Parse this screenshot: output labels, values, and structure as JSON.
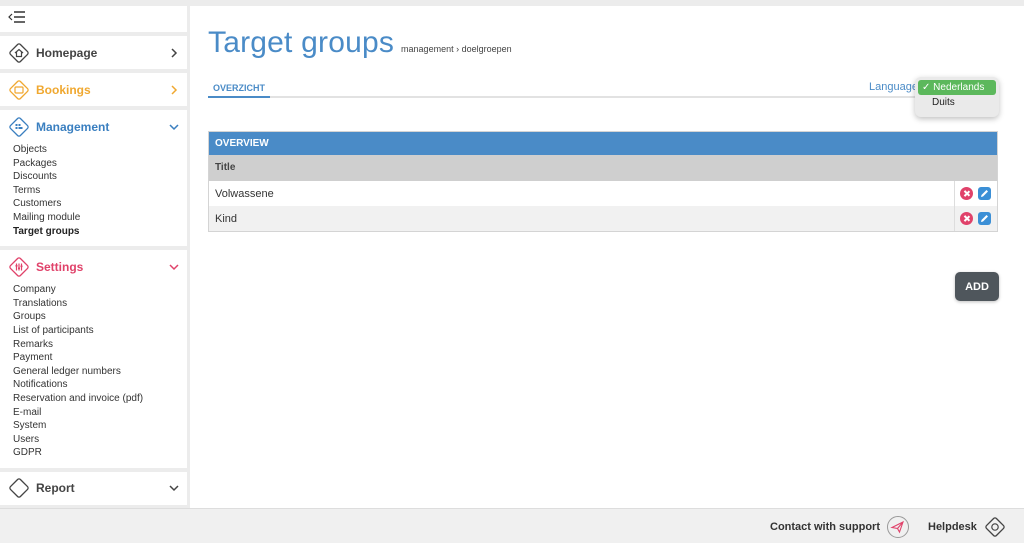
{
  "sidebar": {
    "sections": [
      {
        "label": "Homepage",
        "color": "#444444",
        "icon": "home-icon",
        "chevron": "right"
      },
      {
        "label": "Bookings",
        "color": "#f0a830",
        "icon": "bookings-icon",
        "chevron": "right"
      },
      {
        "label": "Management",
        "color": "#3a7fc0",
        "icon": "management-icon",
        "chevron": "down",
        "items": [
          "Objects",
          "Packages",
          "Discounts",
          "Terms",
          "Customers",
          "Mailing module",
          "Target groups"
        ],
        "active": "Target groups"
      },
      {
        "label": "Settings",
        "color": "#e0426a",
        "icon": "settings-icon",
        "chevron": "down",
        "items": [
          "Company",
          "Translations",
          "Groups",
          "List of participants",
          "Remarks",
          "Payment",
          "General ledger numbers",
          "Notifications",
          "Reservation and invoice (pdf)",
          "E-mail",
          "System",
          "Users",
          "GDPR"
        ]
      },
      {
        "label": "Report",
        "color": "#444444",
        "icon": "report-icon",
        "chevron": "down"
      }
    ]
  },
  "header": {
    "title": "Target groups",
    "breadcrumb": [
      "management",
      "doelgroepen"
    ],
    "breadcrumb_sep": "›"
  },
  "tabs": [
    {
      "label": "OVERZICHT",
      "active": true
    }
  ],
  "language": {
    "label": "Language",
    "options": [
      "Nederlands",
      "Duits"
    ],
    "selected": "Nederlands",
    "check": "✓"
  },
  "overview": {
    "heading": "OVERVIEW",
    "column": "Title",
    "rows": [
      "Volwassene",
      "Kind"
    ]
  },
  "add_label": "ADD",
  "footer": {
    "support": "Contact with support",
    "helpdesk": "Helpdesk"
  },
  "colors": {
    "accent": "#4a8bc7",
    "delete": "#e0426a",
    "edit": "#3b8fd6",
    "selected": "#5cb85c"
  }
}
